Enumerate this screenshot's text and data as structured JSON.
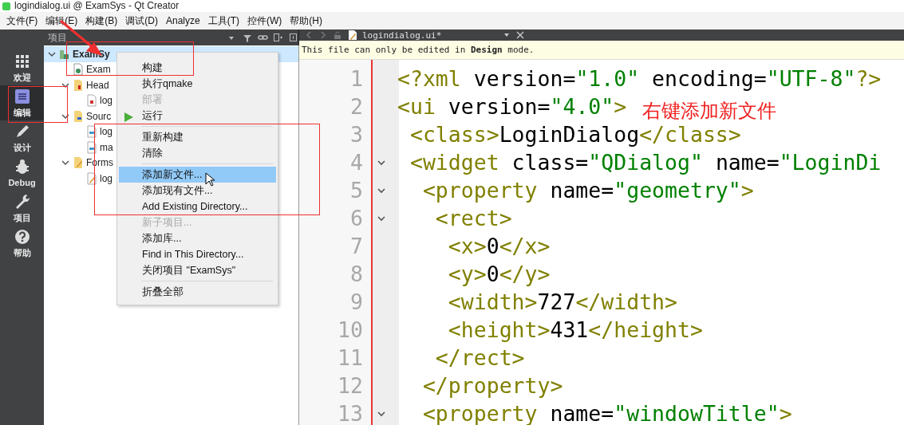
{
  "window": {
    "title": "logindialog.ui @ ExamSys - Qt Creator"
  },
  "menu_bar": [
    "文件(F)",
    "编辑(E)",
    "构建(B)",
    "调试(D)",
    "Analyze",
    "工具(T)",
    "控件(W)",
    "帮助(H)"
  ],
  "mode_bar": [
    {
      "label": "欢迎",
      "selected": false
    },
    {
      "label": "编辑",
      "selected": true
    },
    {
      "label": "设计",
      "selected": false
    },
    {
      "label": "Debug",
      "selected": false
    },
    {
      "label": "项目",
      "selected": false
    },
    {
      "label": "帮助",
      "selected": false
    }
  ],
  "project_panel": {
    "title": "项目",
    "tree": [
      {
        "kind": "project",
        "label": "ExamSy",
        "selected": true,
        "expanded": true,
        "children": [
          {
            "kind": "pro-file",
            "label": "Exam",
            "selected": false
          },
          {
            "kind": "header-folder",
            "label": "Head",
            "selected": false,
            "expanded": true,
            "children": [
              {
                "kind": "header-file",
                "label": "log",
                "selected": false
              }
            ]
          },
          {
            "kind": "source-folder",
            "label": "Sourc",
            "selected": false,
            "expanded": true,
            "children": [
              {
                "kind": "source-file",
                "label": "log",
                "selected": false
              },
              {
                "kind": "source-file",
                "label": "ma",
                "selected": false
              }
            ]
          },
          {
            "kind": "form-folder",
            "label": "Forms",
            "selected": false,
            "expanded": true,
            "children": [
              {
                "kind": "form-file",
                "label": "log",
                "selected": false
              }
            ]
          }
        ]
      }
    ]
  },
  "context_menu": {
    "items": [
      {
        "kind": "item",
        "label": "构建",
        "disabled": false,
        "selected": false
      },
      {
        "kind": "item",
        "label": "执行qmake",
        "disabled": false,
        "selected": false
      },
      {
        "kind": "item",
        "label": "部署",
        "disabled": true,
        "selected": false
      },
      {
        "kind": "run",
        "label": "运行",
        "disabled": false,
        "selected": false
      },
      {
        "kind": "separator"
      },
      {
        "kind": "item",
        "label": "重新构建",
        "disabled": false,
        "selected": false
      },
      {
        "kind": "item",
        "label": "清除",
        "disabled": false,
        "selected": false
      },
      {
        "kind": "separator"
      },
      {
        "kind": "item",
        "label": "添加新文件...",
        "disabled": false,
        "selected": true
      },
      {
        "kind": "item",
        "label": "添加现有文件...",
        "disabled": false,
        "selected": false
      },
      {
        "kind": "item",
        "label": "Add Existing Directory...",
        "disabled": false,
        "selected": false
      },
      {
        "kind": "item",
        "label": "新子项目...",
        "disabled": true,
        "selected": false
      },
      {
        "kind": "item",
        "label": "添加库...",
        "disabled": false,
        "selected": false
      },
      {
        "kind": "item",
        "label": "Find in This Directory...",
        "disabled": false,
        "selected": false
      },
      {
        "kind": "item",
        "label": "关闭项目 \"ExamSys\"",
        "disabled": false,
        "selected": false
      },
      {
        "kind": "separator"
      },
      {
        "kind": "item",
        "label": "折叠全部",
        "disabled": false,
        "selected": false
      }
    ]
  },
  "editor": {
    "tab": "logindialog.ui*",
    "info_bar": "This file can only be edited in **Design** mode.",
    "lines": [
      {
        "number": "1",
        "foldable": false,
        "tokens": [
          {
            "kind": "tag",
            "text": "<?xml"
          },
          {
            "kind": "attr",
            "text": " version="
          },
          {
            "kind": "value",
            "text": "\"1.0\""
          },
          {
            "kind": "attr",
            "text": " encoding="
          },
          {
            "kind": "value",
            "text": "\"UTF-8\""
          },
          {
            "kind": "tag",
            "text": "?>"
          }
        ]
      },
      {
        "number": "2",
        "foldable": false,
        "tokens": [
          {
            "kind": "tag",
            "text": "<ui"
          },
          {
            "kind": "attr",
            "text": " version="
          },
          {
            "kind": "value",
            "text": "\"4.0\""
          },
          {
            "kind": "tag",
            "text": ">"
          }
        ]
      },
      {
        "number": "3",
        "foldable": false,
        "tokens": [
          {
            "kind": "tag",
            "text": " <class>"
          },
          {
            "kind": "text",
            "text": "LoginDialog"
          },
          {
            "kind": "tag",
            "text": "</class>"
          }
        ]
      },
      {
        "number": "4",
        "foldable": true,
        "tokens": [
          {
            "kind": "tag",
            "text": " <widget"
          },
          {
            "kind": "attr",
            "text": " class="
          },
          {
            "kind": "value",
            "text": "\"QDialog\""
          },
          {
            "kind": "attr",
            "text": " name="
          },
          {
            "kind": "value",
            "text": "\"LoginDi"
          }
        ]
      },
      {
        "number": "5",
        "foldable": true,
        "tokens": [
          {
            "kind": "tag",
            "text": "  <property"
          },
          {
            "kind": "attr",
            "text": " name="
          },
          {
            "kind": "value",
            "text": "\"geometry\""
          },
          {
            "kind": "tag",
            "text": ">"
          }
        ]
      },
      {
        "number": "6",
        "foldable": true,
        "tokens": [
          {
            "kind": "tag",
            "text": "   <rect>"
          }
        ]
      },
      {
        "number": "7",
        "foldable": false,
        "tokens": [
          {
            "kind": "tag",
            "text": "    <x>"
          },
          {
            "kind": "text",
            "text": "0"
          },
          {
            "kind": "tag",
            "text": "</x>"
          }
        ]
      },
      {
        "number": "8",
        "foldable": false,
        "tokens": [
          {
            "kind": "tag",
            "text": "    <y>"
          },
          {
            "kind": "text",
            "text": "0"
          },
          {
            "kind": "tag",
            "text": "</y>"
          }
        ]
      },
      {
        "number": "9",
        "foldable": false,
        "tokens": [
          {
            "kind": "tag",
            "text": "    <width>"
          },
          {
            "kind": "text",
            "text": "727"
          },
          {
            "kind": "tag",
            "text": "</width>"
          }
        ]
      },
      {
        "number": "10",
        "foldable": false,
        "tokens": [
          {
            "kind": "tag",
            "text": "    <height>"
          },
          {
            "kind": "text",
            "text": "431"
          },
          {
            "kind": "tag",
            "text": "</height>"
          }
        ]
      },
      {
        "number": "11",
        "foldable": false,
        "tokens": [
          {
            "kind": "tag",
            "text": "   </rect>"
          }
        ]
      },
      {
        "number": "12",
        "foldable": false,
        "tokens": [
          {
            "kind": "tag",
            "text": "  </property>"
          }
        ]
      },
      {
        "number": "13",
        "foldable": true,
        "tokens": [
          {
            "kind": "tag",
            "text": "  <property"
          },
          {
            "kind": "attr",
            "text": " name="
          },
          {
            "kind": "value",
            "text": "\"windowTitle\""
          },
          {
            "kind": "tag",
            "text": ">"
          }
        ]
      }
    ]
  },
  "annotation": {
    "note": "右键添加新文件"
  }
}
